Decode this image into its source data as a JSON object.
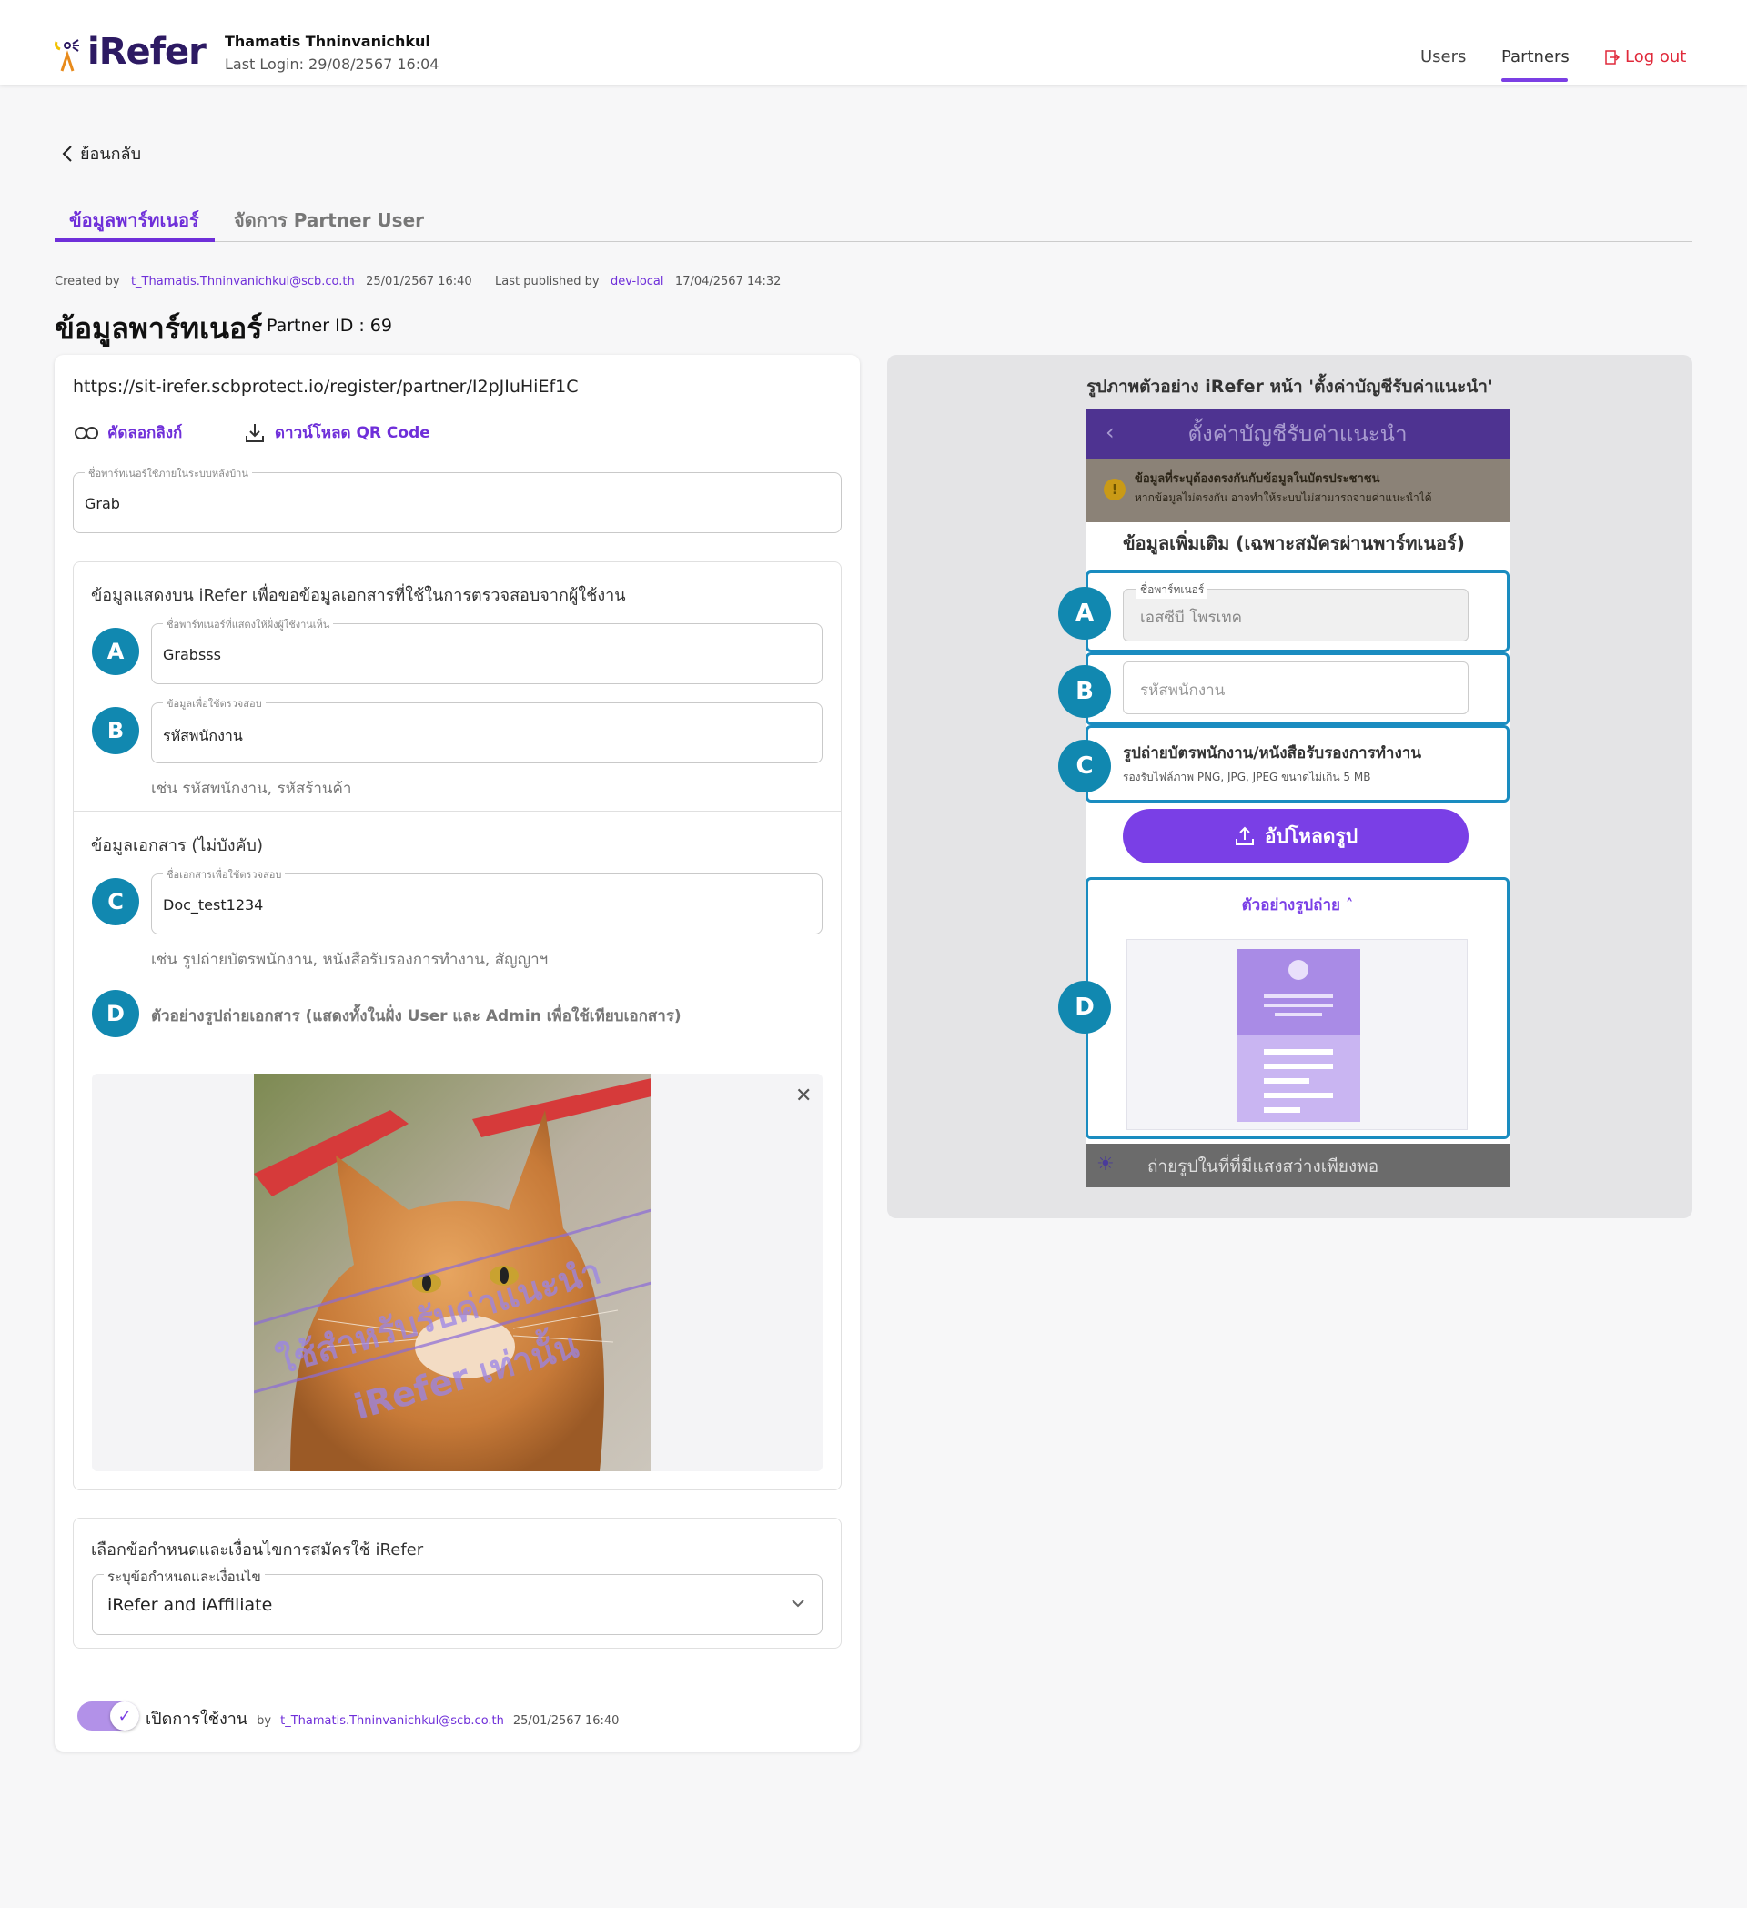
{
  "header": {
    "logo_text": "iRefer",
    "user_name": "Thamatis Thninvanichkul",
    "last_login": "Last Login: 29/08/2567 16:04",
    "nav": {
      "users": "Users",
      "partners": "Partners",
      "logout": "Log out"
    }
  },
  "back_label": "ย้อนกลับ",
  "tabs": {
    "active": "ข้อมูลพาร์ทเนอร์",
    "inactive": "จัดการ Partner User"
  },
  "meta": {
    "created_label": "Created by",
    "created_by": "t_Thamatis.Thninvanichkul@scb.co.th",
    "created_at": "25/01/2567 16:40",
    "published_label": "Last published by",
    "published_by": "dev-local",
    "published_at": "17/04/2567 14:32"
  },
  "title": "ข้อมูลพาร์ทเนอร์",
  "partner_id": "Partner ID : 69",
  "form": {
    "url": "https://sit-irefer.scbprotect.io/register/partner/I2pJIuHiEf1C",
    "copy_link": "คัดลอกลิงก์",
    "download_qr": "ดาวน์โหลด QR Code",
    "backoffice_label": "ชื่อพาร์ทเนอร์ใช้ภายในระบบหลังบ้าน",
    "backoffice_value": "Grab",
    "display_section_title": "ข้อมูลแสดงบน iRefer เพื่อขอข้อมูลเอกสารที่ใช้ในการตรวจสอบจากผู้ใช้งาน",
    "a_label": "ชื่อพาร์ทเนอร์ที่แสดงให้ฝั่งผู้ใช้งานเห็น",
    "a_value": "Grabsss",
    "b_label": "ข้อมูลเพื่อใช้ตรวจสอบ",
    "b_value": "รหัสพนักงาน",
    "b_hint": "เช่น รหัสพนักงาน, รหัสร้านค้า",
    "doc_section_title": "ข้อมูลเอกสาร (ไม่บังคับ)",
    "c_label": "ชื่อเอกสารเพื่อใช้ตรวจสอบ",
    "c_value": "Doc_test1234",
    "c_hint": "เช่น รูปถ่ายบัตรพนักงาน, หนังสือรับรองการทำงาน, สัญญาฯ",
    "d_label": "ตัวอย่างรูปถ่ายเอกสาร (แสดงทั้งในฝั่ง User และ Admin เพื่อใช้เทียบเอกสาร)",
    "watermark_line1": "ใช้สำหรับรับค่าแนะนำ",
    "watermark_line2": "iRefer เท่านั้น",
    "terms_section_title": "เลือกข้อกำหนดและเงื่อนไขการสมัครใช้ iRefer",
    "terms_label": "ระบุข้อกำหนดและเงื่อนไข",
    "terms_value": "iRefer and iAffiliate",
    "enable_label": "เปิดการใช้งาน",
    "enable_by": "by",
    "enable_user": "t_Thamatis.Thninvanichkul@scb.co.th",
    "enable_at": "25/01/2567 16:40"
  },
  "badges": {
    "a": "A",
    "b": "B",
    "c": "C",
    "d": "D"
  },
  "preview": {
    "title": "รูปภาพตัวอย่าง iRefer หน้า 'ตั้งค่าบัญชีรับค่าแนะนำ'",
    "header": "ตั้งค่าบัญชีรับค่าแนะนำ",
    "warn_title": "ข้อมูลที่ระบุต้องตรงกันกับข้อมูลในบัตรประชาชน",
    "warn_body": "หากข้อมูลไม่ตรงกัน อาจทำให้ระบบไม่สามารถจ่ายค่าแนะนำได้",
    "section_title": "ข้อมูลเพิ่มเติม (เฉพาะสมัครผ่านพาร์ทเนอร์)",
    "partner_label": "ชื่อพาร์ทเนอร์",
    "partner_value": "เอสซีบี โพรเทค",
    "employee_placeholder": "รหัสพนักงาน",
    "photo_title": "รูปถ่ายบัตรพนักงาน/หนังสือรับรองการทำงาน",
    "photo_hint": "รองรับไฟล์ภาพ PNG, JPG, JPEG ขนาดไม่เกิน 5 MB",
    "upload": "อัปโหลดรูป",
    "example": "ตัวอย่างรูปถ่าย",
    "bottom_tip": "ถ่ายรูปในที่ที่มีแสงสว่างเพียงพอ"
  },
  "colors": {
    "brand": "#6f2fd9",
    "badge": "#1188b0",
    "logout": "#e0293a"
  }
}
